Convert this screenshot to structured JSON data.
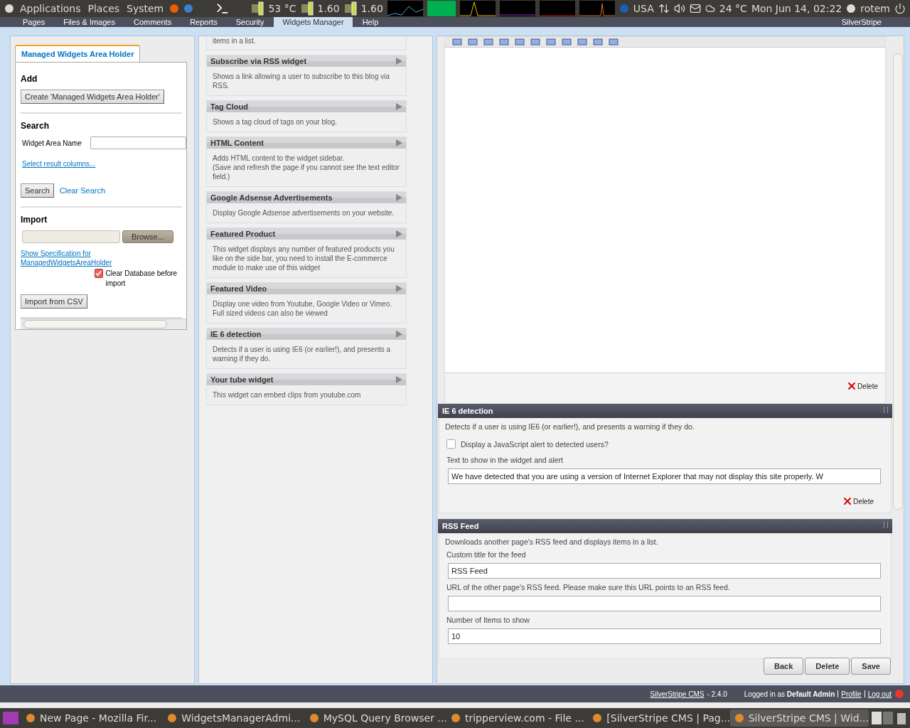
{
  "top_panel": {
    "menus": [
      "Applications",
      "Places",
      "System"
    ],
    "temperature": "53 °C",
    "cpu_freqs": [
      "1.60",
      "1.60"
    ],
    "keyboard_layout": "USA",
    "weather": "24 °C",
    "clock": "Mon Jun 14, 02:22",
    "user": "rotem"
  },
  "cms_tabs": [
    {
      "label": "Pages",
      "selected": false
    },
    {
      "label": "Files & Images",
      "selected": false
    },
    {
      "label": "Comments",
      "selected": false
    },
    {
      "label": "Reports",
      "selected": false
    },
    {
      "label": "Security",
      "selected": false
    },
    {
      "label": "Widgets Manager",
      "selected": true
    },
    {
      "label": "Help",
      "selected": false
    }
  ],
  "cms_brand": "SilverStripe",
  "left_panel": {
    "tab": "Managed Widgets Area Holder",
    "add_heading": "Add",
    "create_button": "Create 'Managed Widgets Area Holder'",
    "search_heading": "Search",
    "search_label": "Widget Area Name",
    "select_columns_link": "Select result columns...",
    "search_button": "Search",
    "clear_search_link": "Clear Search",
    "import_heading": "Import",
    "browse_button": "Browse...",
    "spec_link": "Show Specification for ManagedWidgetsAreaHolder",
    "clear_db": {
      "label": "Clear Database before import",
      "checked": true
    },
    "import_button": "Import from CSV"
  },
  "available_widgets": {
    "partial_text": "items in a list.",
    "items": [
      {
        "title": "Subscribe via RSS widget",
        "description": "Shows a link allowing a user to subscribe to this blog via RSS."
      },
      {
        "title": "Tag Cloud",
        "description": "Shows a tag cloud of tags on your blog."
      },
      {
        "title": "HTML Content",
        "description": "Adds HTML content to the widget sidebar.\n(Save and refresh the page if you cannot see the text editor field.)"
      },
      {
        "title": "Google Adsense Advertisements",
        "description": "Display Google Adsense advertisements on your website."
      },
      {
        "title": "Featured Product",
        "description": "This widget displays any number of featured products you like on the side bar, you need to install the E-commerce module to make use of this widget"
      },
      {
        "title": "Featured Video",
        "description": "Display one video from Youtube, Google Video or Vimeo. Full sized videos can also be viewed"
      },
      {
        "title": "IE 6 detection",
        "description": "Detects if a user is using IE6 (or earlier!), and presents a warning if they do."
      },
      {
        "title": "Your tube widget",
        "description": "This widget can embed clips from youtube.com"
      }
    ]
  },
  "editor": {
    "delete": "Delete"
  },
  "used_widgets": [
    {
      "title": "IE 6 detection",
      "description": "Detects if a user is using IE6 (or earlier!), and presents a warning if they do.",
      "fields": [
        {
          "kind": "checkbox",
          "label": "Display a JavaScript alert to detected users?",
          "checked": false
        },
        {
          "kind": "text",
          "label": "Text to show in the widget and alert",
          "value": "We have detected that you are using a version of Internet Explorer that may not display this site properly. W"
        }
      ],
      "delete": "Delete"
    },
    {
      "title": "RSS Feed",
      "description": "Downloads another page's RSS feed and displays items in a list.",
      "fields": [
        {
          "kind": "text",
          "label": "Custom title for the feed",
          "value": "RSS Feed"
        },
        {
          "kind": "text",
          "label": "URL of the other page's RSS feed. Please make sure this URL points to an RSS feed."
        },
        {
          "kind": "text",
          "label": "Number of Items to show",
          "value": "10"
        }
      ]
    }
  ],
  "actions": [
    "Back",
    "Delete",
    "Save"
  ],
  "footer": {
    "cms_link": "SilverStripe CMS",
    "version": "- 2.4.0",
    "logged_in": "Logged in as **Default Admin**",
    "profile": "Profile",
    "logout": "Log out"
  },
  "taskbar": [
    {
      "label": "New Page - Mozilla Fir...",
      "selected": false
    },
    {
      "label": "WidgetsManagerAdmi...",
      "selected": false
    },
    {
      "label": "MySQL Query Browser ...",
      "selected": false
    },
    {
      "label": "tripperview.com - File ...",
      "selected": false
    },
    {
      "label": "[SilverStripe CMS | Pag...",
      "selected": false
    },
    {
      "label": "SilverStripe CMS | Wid...",
      "selected": true
    }
  ]
}
